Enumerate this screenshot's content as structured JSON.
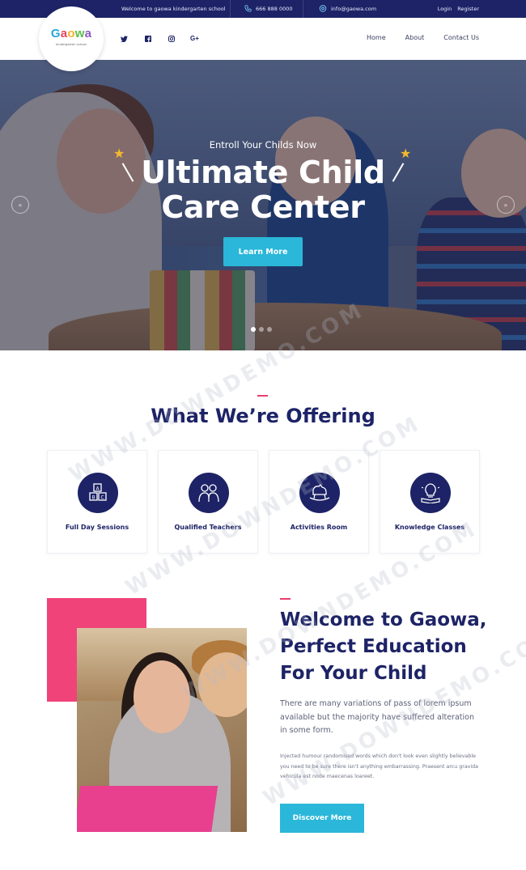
{
  "topbar": {
    "welcome": "Welcome to gaowa kindergarten school",
    "phone": "666 888 0000",
    "email": "info@gaowa.com",
    "login": "Login",
    "register": "Register"
  },
  "header": {
    "logo": {
      "letters": [
        "G",
        "a",
        "o",
        "w",
        "a"
      ],
      "subtitle": "kindergarten school"
    },
    "social": [
      {
        "name": "twitter-icon",
        "glyph": "🐦"
      },
      {
        "name": "facebook-icon",
        "glyph": "f"
      },
      {
        "name": "instagram-icon",
        "glyph": "◎"
      },
      {
        "name": "google-plus-icon",
        "glyph": "G+"
      }
    ],
    "nav": [
      "Home",
      "About",
      "Contact Us"
    ]
  },
  "hero": {
    "eyebrow": "Entroll Your Childs Now",
    "title_line1": "Ultimate Child",
    "title_line2": "Care Center",
    "cta": "Learn More",
    "prev": "«",
    "next": "»",
    "active_slide": 1,
    "slides": 3
  },
  "offering": {
    "title": "What We’re Offering",
    "cards": [
      {
        "label": "Full Day Sessions",
        "icon": "blocks-icon"
      },
      {
        "label": "Qualified Teachers",
        "icon": "teachers-icon"
      },
      {
        "label": "Activities Room",
        "icon": "rocking-horse-icon"
      },
      {
        "label": "Knowledge Classes",
        "icon": "lightbulb-book-icon"
      }
    ]
  },
  "welcome": {
    "title_line1": "Welcome to Gaowa,",
    "title_line2": "Perfect Education",
    "title_line3": "For Your Child",
    "lead": "There are many variations of pass of lorem ipsum available but the majority have suffered alteration in some form.",
    "body": "Injected humour randomised words which don't look even slightly believable you need to be sure there isn't anything embarrassing. Praesent arcu gravida vehicula est node maecenas loareet.",
    "cta": "Discover More"
  },
  "colors": {
    "navy": "#1d2366",
    "accent": "#2ab7d9",
    "pink": "#f0437a"
  }
}
